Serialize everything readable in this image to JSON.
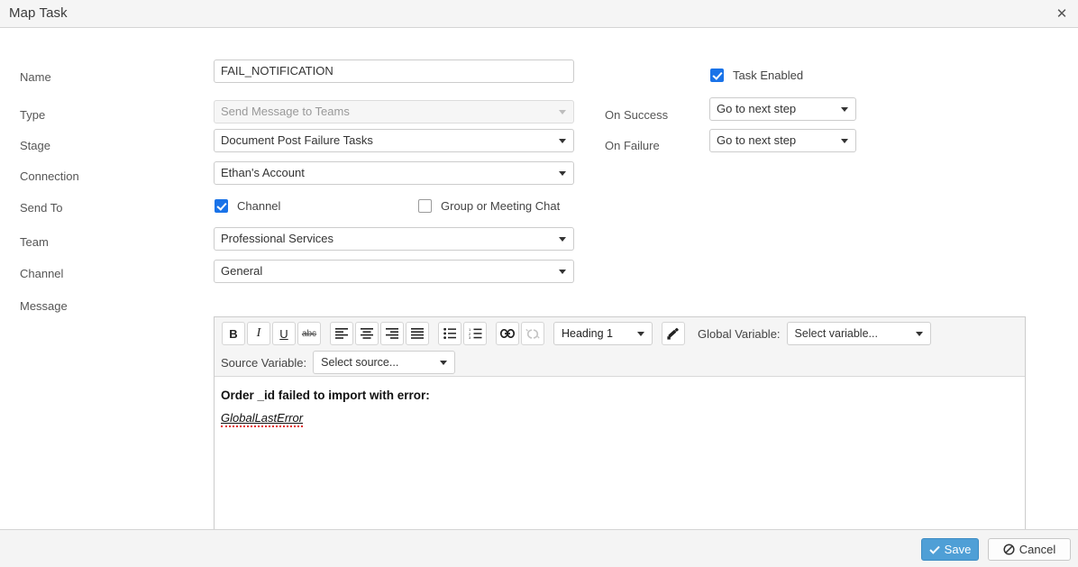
{
  "window": {
    "title": "Map Task",
    "close_icon": "close-icon"
  },
  "form": {
    "name": {
      "label": "Name",
      "value": "FAIL_NOTIFICATION"
    },
    "type": {
      "label": "Type",
      "value": "Send Message to Teams",
      "disabled": true
    },
    "stage": {
      "label": "Stage",
      "value": "Document Post Failure Tasks"
    },
    "connection": {
      "label": "Connection",
      "value": "Ethan's Account"
    },
    "send_to": {
      "label": "Send To",
      "options": [
        {
          "label": "Channel",
          "checked": true
        },
        {
          "label": "Group or Meeting Chat",
          "checked": false
        }
      ]
    },
    "team": {
      "label": "Team",
      "value": "Professional Services"
    },
    "channel": {
      "label": "Channel",
      "value": "General"
    },
    "message": {
      "label": "Message"
    }
  },
  "right_panel": {
    "task_enabled": {
      "label": "Task Enabled",
      "checked": true
    },
    "on_success": {
      "label": "On Success",
      "value": "Go to next step"
    },
    "on_failure": {
      "label": "On Failure",
      "value": "Go to next step"
    }
  },
  "editor": {
    "toolbar": {
      "bold": "B",
      "italic": "I",
      "underline": "U",
      "strikethrough": "abc",
      "heading": "Heading 1",
      "global_variable_label": "Global Variable:",
      "global_variable_value": "Select variable...",
      "source_variable_label": "Source Variable:",
      "source_variable_value": "Select source..."
    },
    "content": {
      "line1": "Order _id failed to import with error:",
      "line2": "GlobalLastError"
    }
  },
  "footer": {
    "save_label": "Save",
    "cancel_label": "Cancel"
  },
  "colors": {
    "accent": "#1a73e8",
    "save_button": "#4f9fd6",
    "titlebar": "#f5f5f5",
    "spellcheck_underline": "#e03030"
  }
}
